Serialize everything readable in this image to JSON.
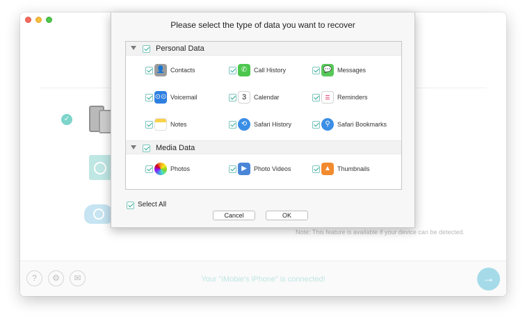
{
  "dialog": {
    "title": "Please select the type of data you want to recover",
    "sections": [
      {
        "label": "Personal Data",
        "items": [
          {
            "label": "Contacts",
            "icon": "contacts-icon",
            "glyph": "👤"
          },
          {
            "label": "Call History",
            "icon": "phone-icon",
            "glyph": "✆"
          },
          {
            "label": "Messages",
            "icon": "messages-icon",
            "glyph": "💬"
          },
          {
            "label": "Voicemail",
            "icon": "voicemail-icon",
            "glyph": "⊙⊙"
          },
          {
            "label": "Calendar",
            "icon": "calendar-icon",
            "glyph": "3"
          },
          {
            "label": "Reminders",
            "icon": "reminders-icon",
            "glyph": "☰"
          },
          {
            "label": "Notes",
            "icon": "notes-icon",
            "glyph": ""
          },
          {
            "label": "Safari History",
            "icon": "safari-history-icon",
            "glyph": "⟲"
          },
          {
            "label": "Safari Bookmarks",
            "icon": "safari-bookmarks-icon",
            "glyph": "⚲"
          }
        ]
      },
      {
        "label": "Media Data",
        "items": [
          {
            "label": "Photos",
            "icon": "photos-icon",
            "glyph": ""
          },
          {
            "label": "Photo Videos",
            "icon": "photo-videos-icon",
            "glyph": "▶"
          },
          {
            "label": "Thumbnails",
            "icon": "thumbnails-icon",
            "glyph": "▲"
          }
        ]
      }
    ],
    "select_all_label": "Select All",
    "cancel_label": "Cancel",
    "ok_label": "OK"
  },
  "background": {
    "note": "Note: This feature is available if your device can be detected.",
    "status": "Your \"iMobie's iPhone\" is connected!"
  },
  "colors": {
    "accent": "#2ea897",
    "checkbox_border": "#7cc6bd",
    "next_button": "#a5dbe9"
  }
}
